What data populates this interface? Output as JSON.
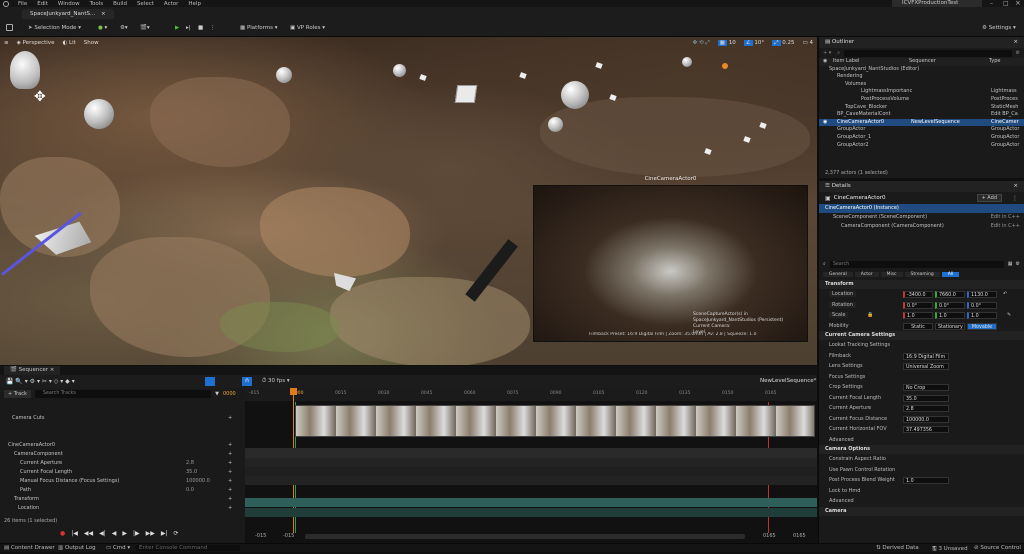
{
  "app": {
    "menu": [
      "File",
      "Edit",
      "Window",
      "Tools",
      "Build",
      "Select",
      "Actor",
      "Help"
    ],
    "project_name": "ICVFXProductionTest",
    "level_tab": "SpaceJunkyard_NantS...",
    "accent": "#1f6fce"
  },
  "toolbar": {
    "mode": "Selection Mode",
    "platforms": "Platforms",
    "vp_roles": "VP Roles",
    "settings": "Settings"
  },
  "viewport": {
    "perspective": "Perspective",
    "lit": "Lit",
    "show": "Show",
    "snap_values": [
      "10",
      "10°",
      "0.25",
      "4"
    ],
    "pip_title": "CineCameraActor0",
    "overlay_lines": [
      "SceneCaptureActor(s) in",
      "SpaceJunkyard_NantStudios (Persistent)",
      "Current Camera:",
      "Level"
    ],
    "filmback_text": "Filmback Preset: 16:9 Digital Film | Zoom: 35.0mm | Av: 2.8 | Squeeze: 1.0"
  },
  "outliner": {
    "title": "Outliner",
    "columns": [
      "Item Label",
      "Sequencer",
      "Type"
    ],
    "rows": [
      {
        "label": "SpaceJunkyard_NantStudios (Editor)",
        "seq": "",
        "type": ""
      },
      {
        "label": "Rendering",
        "seq": "",
        "type": ""
      },
      {
        "label": "Volumes",
        "seq": "",
        "type": ""
      },
      {
        "label": "LightmassImportanc",
        "seq": "",
        "type": "Lightmass"
      },
      {
        "label": "PostProcessVolume",
        "seq": "",
        "type": "PostProces"
      },
      {
        "label": "TopCave_Blocker",
        "seq": "",
        "type": "StaticMesh"
      },
      {
        "label": "BP_CaveMaterialCont",
        "seq": "",
        "type": "Edit BP_Ca"
      },
      {
        "label": "CineCameraActor0",
        "seq": "NewLevelSequence",
        "type": "CineCamer"
      },
      {
        "label": "GroupActor",
        "seq": "",
        "type": "GroupActor"
      },
      {
        "label": "GroupActor_1",
        "seq": "",
        "type": "GroupActor"
      },
      {
        "label": "GroupActor2",
        "seq": "",
        "type": "GroupActor"
      }
    ],
    "footer": "2,377 actors (1 selected)"
  },
  "details": {
    "title": "Details",
    "actor": "CineCameraActor0",
    "add": "+ Add",
    "instance": "CineCameraActor0 (Instance)",
    "components": [
      {
        "label": "SceneComponent (SceneComponent)",
        "link": "Edit in C++"
      },
      {
        "label": "CameraComponent (CameraComponent)",
        "link": "Edit in C++"
      }
    ],
    "search_placeholder": "Search",
    "filter_tabs": [
      "General",
      "Actor",
      "Misc",
      "Streaming",
      "All"
    ],
    "transform_label": "Transform",
    "location": {
      "label": "Location",
      "x": "-3400.0",
      "y": "7660.0",
      "z": "1130.0"
    },
    "rotation": {
      "label": "Rotation",
      "x": "0.0°",
      "y": "0.0°",
      "z": "0.0°"
    },
    "scale": {
      "label": "Scale",
      "x": "1.0",
      "y": "1.0",
      "z": "1.0"
    },
    "mobility": {
      "label": "Mobility",
      "opts": [
        "Static",
        "Stationary",
        "Movable"
      ]
    },
    "cam_settings_label": "Current Camera Settings",
    "props": [
      {
        "label": "Lookat Tracking Settings",
        "value": ""
      },
      {
        "label": "Filmback",
        "value": "16:9 Digital Film"
      },
      {
        "label": "Lens Settings",
        "value": "Universal Zoom"
      },
      {
        "label": "Focus Settings",
        "value": ""
      },
      {
        "label": "Crop Settings",
        "value": "No Crop"
      },
      {
        "label": "Current Focal Length",
        "value": "35.0"
      },
      {
        "label": "Current Aperture",
        "value": "2.8"
      },
      {
        "label": "Current Focus Distance",
        "value": "100000.0"
      },
      {
        "label": "Current Horizontal FOV",
        "value": "37.497356"
      },
      {
        "label": "Advanced",
        "value": ""
      }
    ],
    "camera_options_label": "Camera Options",
    "camera_options": [
      {
        "label": "Constrain Aspect Ratio",
        "value": ""
      },
      {
        "label": "Use Pawn Control Rotation",
        "value": ""
      },
      {
        "label": "Post Process Blend Weight",
        "value": "1.0"
      },
      {
        "label": "Lock to Hmd",
        "value": ""
      },
      {
        "label": "Advanced",
        "value": ""
      }
    ],
    "camera_section": "Camera"
  },
  "sequencer": {
    "tab": "Sequencer",
    "fps": "30 fps",
    "sequence_name": "NewLevelSequence*",
    "add_track": "+ Track",
    "search_placeholder": "Search Tracks",
    "frame": "0000",
    "tracks": [
      {
        "label": "Camera Cuts",
        "value": ""
      },
      {
        "label": "CineCameraActor0",
        "value": ""
      },
      {
        "label": "CameraComponent",
        "value": ""
      },
      {
        "label": "Current Aperture",
        "value": "2.8"
      },
      {
        "label": "Current Focal Length",
        "value": "35.0"
      },
      {
        "label": "Manual Focus Distance (Focus Settings)",
        "value": "100000.0"
      },
      {
        "label": "Path",
        "value": "0.0"
      },
      {
        "label": "Transform",
        "value": ""
      },
      {
        "label": "Location",
        "value": ""
      }
    ],
    "footer": "26 items (1 selected)",
    "ruler": [
      "-015",
      "0000",
      "0015",
      "0030",
      "0045",
      "0060",
      "0075",
      "0090",
      "0105",
      "0120",
      "0135",
      "0150",
      "0165"
    ],
    "start": "-015",
    "start2": "-015",
    "end": "0165",
    "end2": "0165"
  },
  "statusbar": {
    "content_drawer": "Content Drawer",
    "output_log": "Output Log",
    "cmd": "Cmd",
    "console_placeholder": "Enter Console Command",
    "derived_data": "Derived Data",
    "unsaved": "3 Unsaved",
    "source_control": "Source Control"
  }
}
